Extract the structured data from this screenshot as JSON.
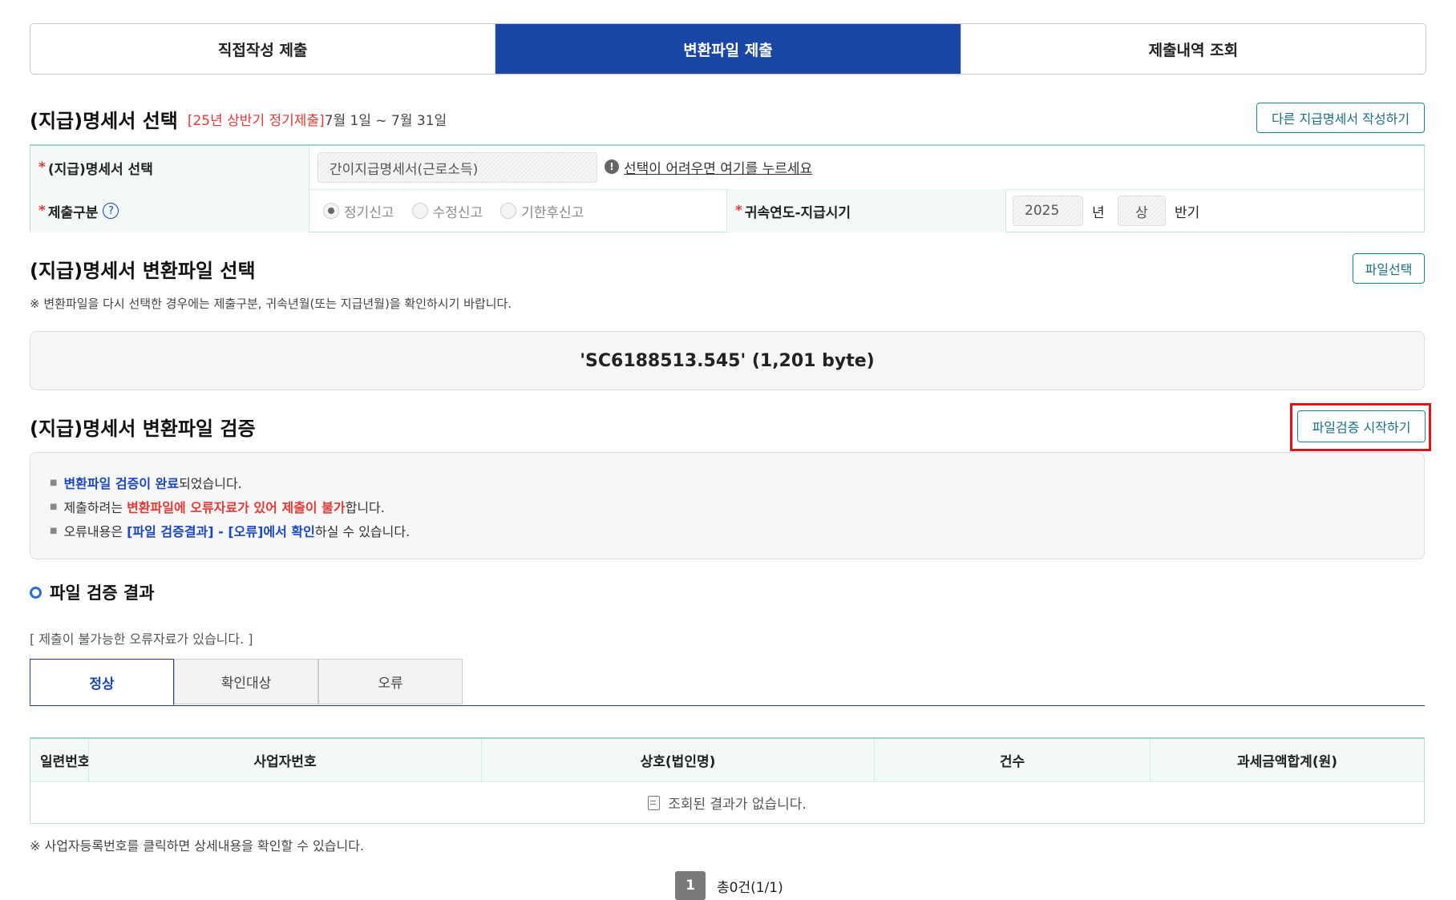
{
  "top_tabs": [
    {
      "label": "직접작성 제출",
      "active": false
    },
    {
      "label": "변환파일 제출",
      "active": true
    },
    {
      "label": "제출내역 조회",
      "active": false
    }
  ],
  "section1": {
    "title": "(지급)명세서 선택",
    "period_badge": "[25년 상반기 정기제출]",
    "period_range": "7월 1일 ~ 7월 31일",
    "other_button": "다른 지급명세서 작성하기"
  },
  "form": {
    "row1": {
      "required_mark": "*",
      "label": "(지급)명세서 선택",
      "value": "간이지급명세서(근로소득)",
      "help_link": "선택이 어려우면 여기를 누르세요"
    },
    "row2": {
      "required_mark": "*",
      "label": "제출구분",
      "radios": [
        "정기신고",
        "수정신고",
        "기한후신고"
      ],
      "selected": "정기신고",
      "label2": "귀속연도-지급시기",
      "year": "2025",
      "year_unit": "년",
      "half": "상",
      "half_unit": "반기"
    }
  },
  "section2": {
    "title": "(지급)명세서 변환파일 선택",
    "file_button": "파일선택",
    "note": "※ 변환파일을 다시 선택한 경우에는 제출구분, 귀속년월(또는 지급년월)을 확인하시기 바랍니다.",
    "file_display": "'SC6188513.545' (1,201 byte)"
  },
  "section3": {
    "title": "(지급)명세서 변환파일 검증",
    "verify_button": "파일검증 시작하기",
    "messages": {
      "line1": {
        "a": "변환파일 검증이 완료",
        "b": "되었습니다."
      },
      "line2": {
        "a": "제출하려는 ",
        "b": "변환파일에 오류자료가 있어 제출이 불가",
        "c": "합니다."
      },
      "line3": {
        "a": "오류내용은 ",
        "b": "[파일 검증결과] - [오류]에서 확인",
        "c": "하실 수 있습니다."
      }
    }
  },
  "results": {
    "title": "파일 검증 결과",
    "status_text": "[ 제출이 불가능한 오류자료가 있습니다. ]",
    "tabs": [
      {
        "label": "정상",
        "active": true
      },
      {
        "label": "확인대상",
        "active": false
      },
      {
        "label": "오류",
        "active": false
      }
    ],
    "columns": [
      "일련번호",
      "사업자번호",
      "상호(법인명)",
      "건수",
      "과세금액합계(원)"
    ],
    "empty_message": "조회된 결과가 없습니다.",
    "footnote": "※ 사업자등록번호를 클릭하면 상세내용을 확인할 수 있습니다."
  },
  "pagination": {
    "current_page": "1",
    "total_text": "총0건(1/1)"
  },
  "colors": {
    "primary": "#1a47a6",
    "accent_teal": "#1d8a8a",
    "error_red": "#e53935",
    "highlight_box": "#e0121a"
  }
}
